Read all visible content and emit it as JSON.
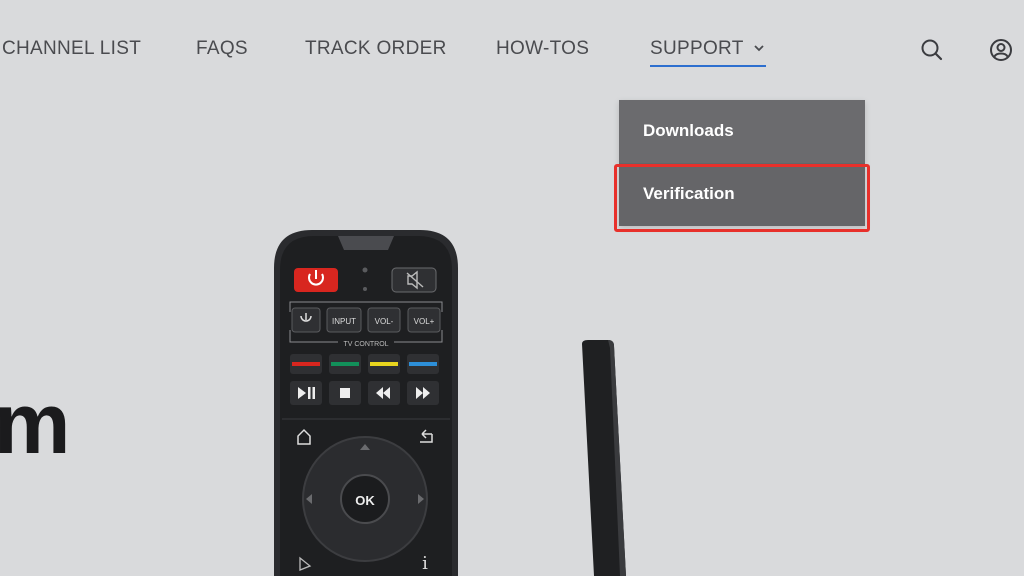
{
  "nav": {
    "links": [
      "CHANNEL LIST",
      "FAQS",
      "TRACK ORDER",
      "HOW-TOS"
    ],
    "support_label": "SUPPORT"
  },
  "dropdown": {
    "items": [
      "Downloads",
      "Verification"
    ]
  },
  "hero": {
    "partial_heading": "m"
  },
  "remote": {
    "buttons": {
      "input": "INPUT",
      "vol_down": "VOL-",
      "vol_up": "VOL+",
      "tv_control": "TV CONTROL",
      "ok": "OK",
      "info": "i"
    }
  },
  "colors": {
    "background": "#d9dadc",
    "nav_text": "#4a4b4f",
    "active_underline": "#2d6fcf",
    "dropdown_bg": "#6b6b6e",
    "highlight_border": "#e8302b"
  }
}
